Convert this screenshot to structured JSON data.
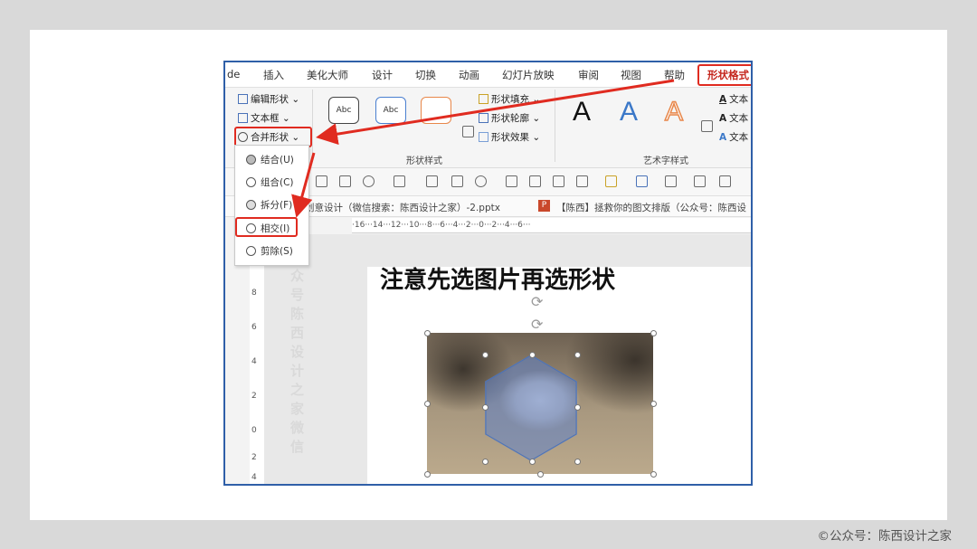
{
  "menubar": {
    "items": [
      {
        "label": "de"
      },
      {
        "label": "插入"
      },
      {
        "label": "美化大师"
      },
      {
        "label": "设计"
      },
      {
        "label": "切换"
      },
      {
        "label": "动画"
      },
      {
        "label": "幻灯片放映"
      },
      {
        "label": "审阅"
      },
      {
        "label": "视图"
      },
      {
        "label": "帮助"
      },
      {
        "label": "形状格式"
      }
    ]
  },
  "ribbon": {
    "insert_shapes": {
      "edit_shape": "编辑形状 ⌄",
      "text_box": "文本框 ⌄",
      "merge_shapes": "合并形状 ⌄"
    },
    "shape_styles": {
      "thumb_label": "Abc",
      "fill": "形状填充 ⌄",
      "outline": "形状轮廓 ⌄",
      "effects": "形状效果 ⌄",
      "group_label": "形状样式"
    },
    "wordart": {
      "letter": "A",
      "text_fill": "文本",
      "text_outline": "文本",
      "text_effects": "文本",
      "group_label": "艺术字样式"
    }
  },
  "merge_menu": {
    "items": [
      {
        "label": "结合(U)"
      },
      {
        "label": "组合(C)"
      },
      {
        "label": "拆分(F)"
      },
      {
        "label": "相交(I)"
      },
      {
        "label": "剪除(S)"
      }
    ]
  },
  "doc_tabs": {
    "tab1": "创意设计（微信搜索：陈西设计之家）-2.pptx",
    "tab2": "【陈西】拯救你的图文排版（公众号：陈西设"
  },
  "ruler": {
    "h_text": "·16···14···12···10···8···6···4···2···0···2···4···6···",
    "v_ticks": [
      "8",
      "6",
      "4",
      "2",
      "0",
      "2",
      "4"
    ]
  },
  "slide": {
    "title": "注意先选图片再选形状",
    "watermark": "众号陈西设计之家微信"
  },
  "footer": {
    "credit": "©公众号：陈西设计之家"
  },
  "colors": {
    "highlight": "#e02b20",
    "window_border": "#2f5fa8",
    "wordart_blue": "#3b78c8",
    "wordart_orange": "#e8874a"
  }
}
